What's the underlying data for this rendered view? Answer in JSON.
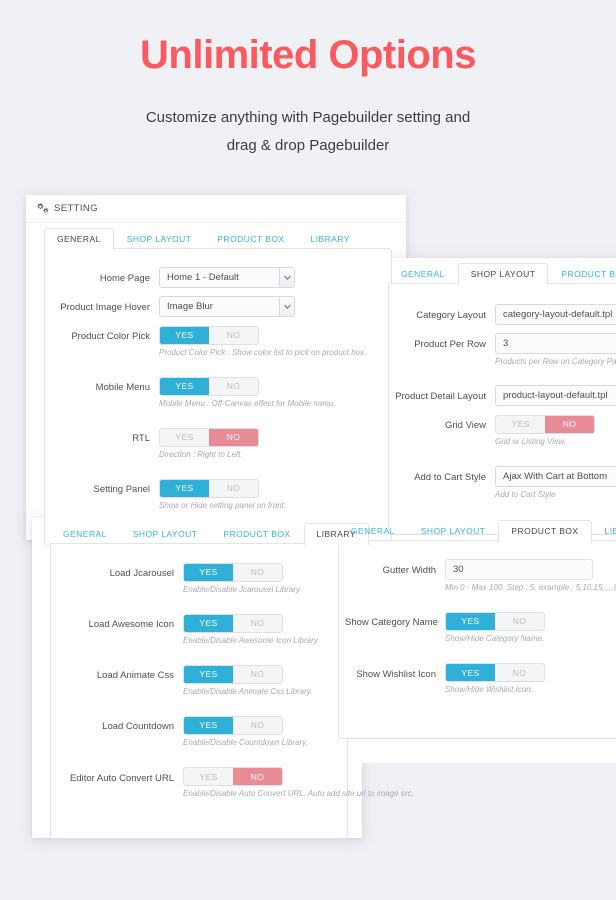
{
  "hero": {
    "title": "Unlimited Options",
    "subtitle_line1": "Customize anything with Pagebuilder setting and",
    "subtitle_line2": "drag & drop Pagebuilder",
    "title_color": "#fa5a5f"
  },
  "colors": {
    "page_background": "#f0f1f5",
    "toggle_yes": "#2fb0d9",
    "toggle_no": "#e88b96",
    "tab_link": "#37b3e3",
    "tab_active_text": "#44474c"
  },
  "panel_header": {
    "icon": "gears-icon",
    "title": "SETTING"
  },
  "tabs": {
    "general": "GENERAL",
    "shop_layout": "SHOP LAYOUT",
    "product_box": "PRODUCT BOX",
    "library": "LIBRARY"
  },
  "toggle": {
    "yes": "YES",
    "no": "NO"
  },
  "panels": {
    "general": {
      "active_tab": "GENERAL",
      "fields": [
        {
          "type": "select",
          "label": "Home Page",
          "value": "Home 1 - Default",
          "hint": ""
        },
        {
          "type": "select",
          "label": "Product Image Hover",
          "value": "Image Blur",
          "hint": ""
        },
        {
          "type": "toggle",
          "label": "Product Color Pick",
          "state": "yes",
          "hint": "Product Color Pick : Show color list to pick on product box."
        },
        {
          "type": "toggle",
          "label": "Mobile Menu",
          "state": "yes",
          "hint": "Mobile Menu : Off-Canvas effect for Mobile menu."
        },
        {
          "type": "toggle",
          "label": "RTL",
          "state": "no",
          "hint": "Direction : Right to Left."
        },
        {
          "type": "toggle",
          "label": "Setting Panel",
          "state": "yes",
          "hint": "Show or Hide setting panel on front."
        }
      ]
    },
    "shop_layout": {
      "active_tab": "SHOP LAYOUT",
      "fields": [
        {
          "type": "select",
          "label": "Category Layout",
          "value": "category-layout-default.tpl",
          "hint": ""
        },
        {
          "type": "select",
          "label": "Product Per Row",
          "value": "3",
          "hint": "Products per Row on Category Page"
        },
        {
          "type": "select",
          "label": "Product Detail Layout",
          "value": "product-layout-default.tpl",
          "hint": ""
        },
        {
          "type": "toggle",
          "label": "Grid View",
          "state": "no",
          "hint": "Grid or Listing View."
        },
        {
          "type": "select",
          "label": "Add to Cart Style",
          "value": "Ajax With Cart at Bottom",
          "hint": "Add to Cart Style"
        }
      ]
    },
    "product_box": {
      "active_tab": "PRODUCT BOX",
      "fields": [
        {
          "type": "text",
          "label": "Gutter Width",
          "value": "30",
          "hint": "Min 0 - Max 100, Step : 5, example : 5,10,15,....9"
        },
        {
          "type": "toggle",
          "label": "Show Category Name",
          "state": "yes",
          "hint": "Show/Hide Category Name."
        },
        {
          "type": "toggle",
          "label": "Show Wishlist Icon",
          "state": "yes",
          "hint": "Show/Hide Wishlist Icon."
        }
      ]
    },
    "library": {
      "active_tab": "LIBRARY",
      "fields": [
        {
          "type": "toggle",
          "label": "Load Jcarousel",
          "state": "yes",
          "hint": "Enable/Disable Jcarousel Library."
        },
        {
          "type": "toggle",
          "label": "Load Awesome Icon",
          "state": "yes",
          "hint": "Enable/Disable Awesome Icon Library."
        },
        {
          "type": "toggle",
          "label": "Load Animate Css",
          "state": "yes",
          "hint": "Enable/Disable Animate Css Library."
        },
        {
          "type": "toggle",
          "label": "Load Countdown",
          "state": "yes",
          "hint": "Enable/Disable Countdown Library."
        },
        {
          "type": "toggle",
          "label": "Editor Auto Convert URL",
          "state": "no",
          "hint": "Enable/Disable Auto Convert URL. Auto add site url to image src."
        }
      ]
    }
  }
}
